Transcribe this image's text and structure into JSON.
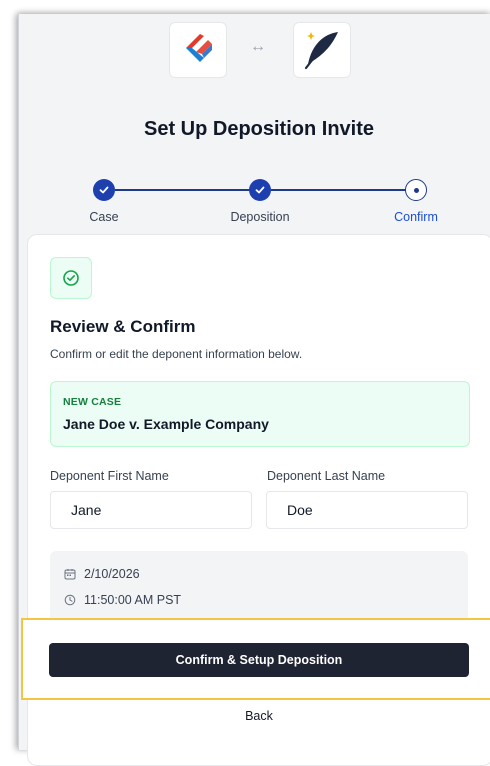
{
  "header": {
    "swap_symbol": "↔",
    "title": "Set Up Deposition Invite"
  },
  "stepper": {
    "steps": [
      {
        "label": "Case",
        "state": "complete"
      },
      {
        "label": "Deposition",
        "state": "complete"
      },
      {
        "label": "Confirm",
        "state": "current"
      }
    ]
  },
  "review": {
    "title": "Review & Confirm",
    "subtitle": "Confirm or edit the deponent information below."
  },
  "case": {
    "label": "NEW CASE",
    "name": "Jane Doe v. Example Company"
  },
  "form": {
    "first_name_label": "Deponent First Name",
    "first_name_value": "Jane",
    "last_name_label": "Deponent Last Name",
    "last_name_value": "Doe"
  },
  "schedule": {
    "date": "2/10/2026",
    "time": "11:50:00 AM PST"
  },
  "actions": {
    "confirm_label": "Confirm & Setup Deposition",
    "back_label": "Back"
  },
  "colors": {
    "primary": "#1e40af",
    "button": "#1f2433",
    "success": "#15803d",
    "highlight": "#f5c542"
  }
}
